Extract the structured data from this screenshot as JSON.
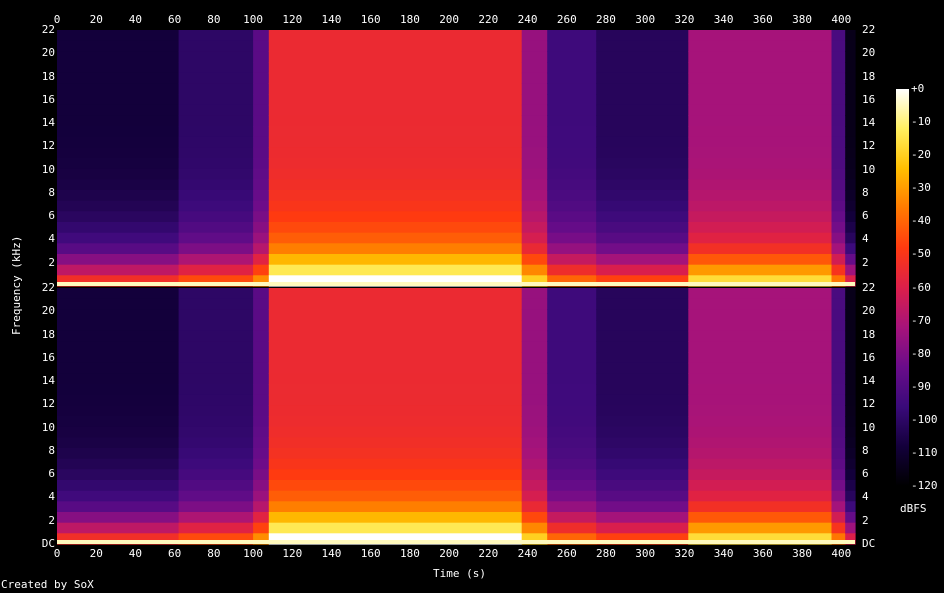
{
  "chart_data": {
    "type": "heatmap",
    "xlabel": "Time (s)",
    "ylabel": "Frequency (kHz)",
    "xlim": [
      0,
      407
    ],
    "ylim": [
      0,
      22
    ],
    "x_ticks": [
      0,
      20,
      40,
      60,
      80,
      100,
      120,
      140,
      160,
      180,
      200,
      220,
      240,
      260,
      280,
      300,
      320,
      340,
      360,
      380,
      400
    ],
    "y_ticks": [
      {
        "value": 22,
        "label": "22"
      },
      {
        "value": 20,
        "label": "20"
      },
      {
        "value": 18,
        "label": "18"
      },
      {
        "value": 16,
        "label": "16"
      },
      {
        "value": 14,
        "label": "14"
      },
      {
        "value": 12,
        "label": "12"
      },
      {
        "value": 10,
        "label": "10"
      },
      {
        "value": 8,
        "label": "8"
      },
      {
        "value": 6,
        "label": "6"
      },
      {
        "value": 4,
        "label": "4"
      },
      {
        "value": 2,
        "label": "2"
      }
    ],
    "bottom_tick_label": "DC",
    "channels": 2,
    "colorbar": {
      "unit": "dBFS",
      "range": [
        -120,
        0
      ],
      "ticks": [
        {
          "value": 0,
          "label": "+0"
        },
        {
          "value": -10,
          "label": "-10"
        },
        {
          "value": -20,
          "label": "-20"
        },
        {
          "value": -30,
          "label": "-30"
        },
        {
          "value": -40,
          "label": "-40"
        },
        {
          "value": -50,
          "label": "-50"
        },
        {
          "value": -60,
          "label": "-60"
        },
        {
          "value": -70,
          "label": "-70"
        },
        {
          "value": -80,
          "label": "-80"
        },
        {
          "value": -90,
          "label": "-90"
        },
        {
          "value": -100,
          "label": "-100"
        },
        {
          "value": -110,
          "label": "-110"
        },
        {
          "value": -120,
          "label": "-120"
        }
      ]
    },
    "segments": [
      {
        "t0": 0,
        "t1": 62,
        "level_db": -108
      },
      {
        "t0": 62,
        "t1": 100,
        "level_db": -100
      },
      {
        "t0": 100,
        "t1": 108,
        "level_db": -88
      },
      {
        "t0": 108,
        "t1": 237,
        "level_db": -55
      },
      {
        "t0": 237,
        "t1": 250,
        "level_db": -75
      },
      {
        "t0": 250,
        "t1": 275,
        "level_db": -95
      },
      {
        "t0": 275,
        "t1": 322,
        "level_db": -102
      },
      {
        "t0": 322,
        "t1": 395,
        "level_db": -72
      },
      {
        "t0": 395,
        "t1": 402,
        "level_db": -92
      },
      {
        "t0": 402,
        "t1": 407,
        "level_db": -115
      }
    ],
    "colors": {
      "background": "#000000",
      "scale": [
        "#000000",
        "#13003b",
        "#3a0a7a",
        "#6a0c8a",
        "#a6137a",
        "#dc1f4a",
        "#ff3a10",
        "#ff7a00",
        "#ffbf00",
        "#fff060",
        "#ffffff"
      ]
    }
  },
  "footer": {
    "credit": "Created by SoX"
  }
}
